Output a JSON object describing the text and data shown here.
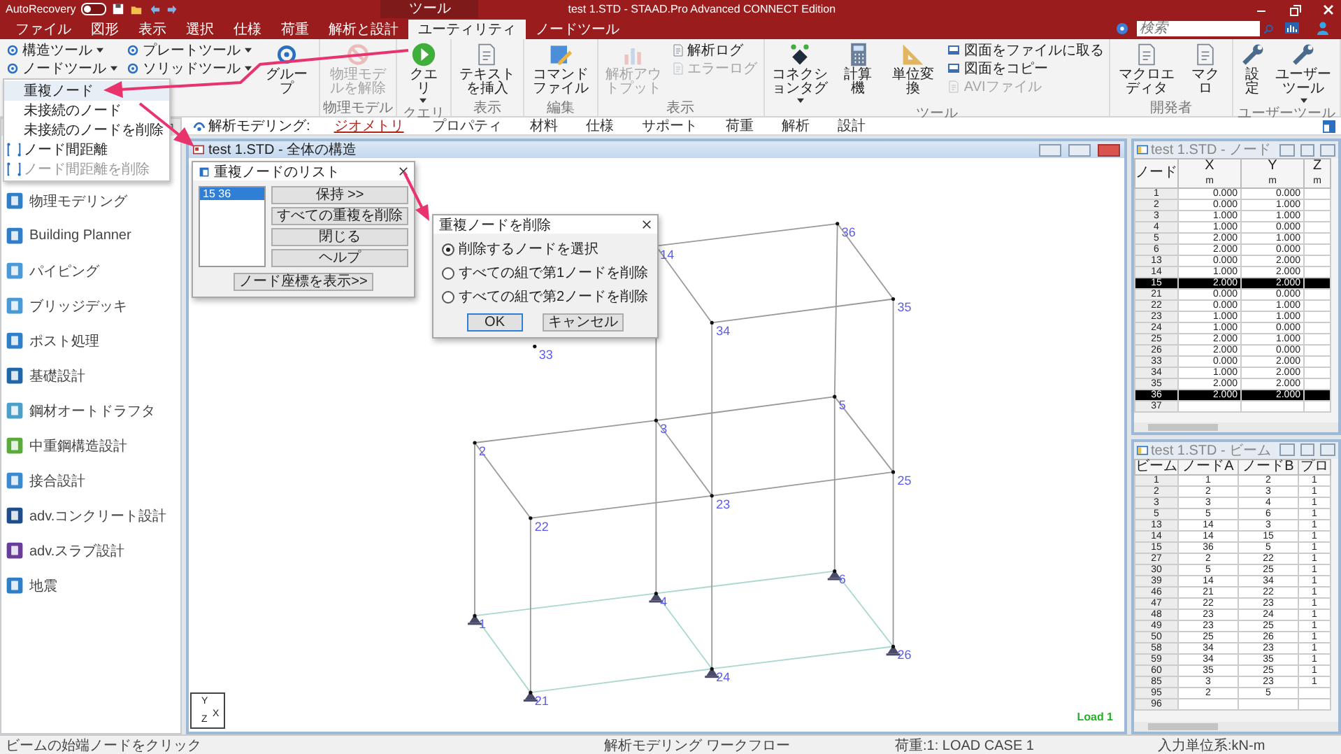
{
  "title_bar": {
    "autorecovery": "AutoRecovery",
    "autorecovery_on": false,
    "context_label": "ツール",
    "title": "test 1.STD - STAAD.Pro Advanced CONNECT Edition"
  },
  "tabs": [
    {
      "label": "ファイル",
      "selected": false
    },
    {
      "label": "図形",
      "selected": false
    },
    {
      "label": "表示",
      "selected": false
    },
    {
      "label": "選択",
      "selected": false
    },
    {
      "label": "仕様",
      "selected": false
    },
    {
      "label": "荷重",
      "selected": false
    },
    {
      "label": "解析と設計",
      "selected": false
    },
    {
      "label": "ユーティリティ",
      "selected": true
    },
    {
      "label": "ノードツール",
      "selected": false
    }
  ],
  "search": {
    "placeholder": "検索"
  },
  "ribbon": {
    "groups": [
      {
        "columns": [
          [
            {
              "kind": "small",
              "label": "構造ツール",
              "dropdown": true,
              "disabled": false
            },
            {
              "kind": "small",
              "label": "ノードツール",
              "dropdown": true,
              "disabled": false
            }
          ],
          [
            {
              "kind": "small",
              "label": "プレートツール",
              "dropdown": true,
              "disabled": false
            },
            {
              "kind": "small",
              "label": "ソリッドツール",
              "dropdown": true,
              "disabled": false
            }
          ],
          [
            {
              "kind": "large",
              "label": "グループ",
              "dropdown": false,
              "disabled": false
            }
          ]
        ]
      },
      {
        "label": "物理モデル",
        "columns": [
          [
            {
              "kind": "large",
              "label": "物理モデルを解除",
              "dropdown": false,
              "disabled": true
            }
          ]
        ]
      },
      {
        "label": "クエリ",
        "columns": [
          [
            {
              "kind": "large",
              "label": "クエリ",
              "dropdown": true,
              "disabled": false
            }
          ]
        ]
      },
      {
        "label": "表示",
        "columns": [
          [
            {
              "kind": "large",
              "label": "テキストを挿入",
              "dropdown": false,
              "disabled": false
            }
          ]
        ]
      },
      {
        "label": "編集",
        "columns": [
          [
            {
              "kind": "large",
              "label": "コマンドファイル",
              "dropdown": false,
              "disabled": false
            }
          ]
        ]
      },
      {
        "label": "表示",
        "columns": [
          [
            {
              "kind": "large",
              "label": "解析アウトプット",
              "dropdown": false,
              "disabled": true
            }
          ],
          [
            {
              "kind": "small",
              "label": "解析ログ",
              "dropdown": false,
              "disabled": false
            },
            {
              "kind": "small",
              "label": "エラーログ",
              "dropdown": false,
              "disabled": true
            }
          ]
        ]
      },
      {
        "label": "ツール",
        "columns": [
          [
            {
              "kind": "large",
              "label": "コネクションタグ",
              "dropdown": true,
              "disabled": false
            }
          ],
          [
            {
              "kind": "large",
              "label": "計算機",
              "dropdown": false,
              "disabled": false
            }
          ],
          [
            {
              "kind": "large",
              "label": "単位変換",
              "dropdown": false,
              "disabled": false
            }
          ],
          [
            {
              "kind": "small",
              "label": "図面をファイルに取る",
              "dropdown": false,
              "disabled": false
            },
            {
              "kind": "small",
              "label": "図面をコピー",
              "dropdown": false,
              "disabled": false
            },
            {
              "kind": "small",
              "label": "AVIファイル",
              "dropdown": false,
              "disabled": true
            }
          ]
        ]
      },
      {
        "label": "開発者",
        "columns": [
          [
            {
              "kind": "large",
              "label": "マクロエディタ",
              "dropdown": false,
              "disabled": false
            }
          ],
          [
            {
              "kind": "large",
              "label": "マクロ",
              "dropdown": false,
              "disabled": false
            }
          ]
        ]
      },
      {
        "label": "ユーザーツール",
        "columns": [
          [
            {
              "kind": "large",
              "label": "設定",
              "dropdown": false,
              "disabled": false
            }
          ],
          [
            {
              "kind": "large",
              "label": "ユーザーツール",
              "dropdown": true,
              "disabled": false
            }
          ]
        ]
      }
    ]
  },
  "node_menu": {
    "items": [
      {
        "label": "重複ノード",
        "kind": "text",
        "disabled": false
      },
      {
        "label": "未接続のノード",
        "kind": "text",
        "disabled": false
      },
      {
        "label": "未接続のノードを削除",
        "kind": "text",
        "disabled": false
      },
      {
        "label": "ノード間距離",
        "kind": "icon",
        "disabled": false
      },
      {
        "label": "ノード間距離を削除",
        "kind": "icon",
        "disabled": true
      }
    ]
  },
  "workflow": {
    "label": "解析モデリング:",
    "steps": [
      {
        "label": "ジオメトリ",
        "selected": true
      },
      {
        "label": "プロパティ",
        "selected": false
      },
      {
        "label": "材料",
        "selected": false
      },
      {
        "label": "仕様",
        "selected": false
      },
      {
        "label": "サポート",
        "selected": false
      },
      {
        "label": "荷重",
        "selected": false
      },
      {
        "label": "解析",
        "selected": false
      },
      {
        "label": "設計",
        "selected": false
      }
    ]
  },
  "sidebar": {
    "items": [
      {
        "label": "物理モデリング"
      },
      {
        "label": "Building Planner"
      },
      {
        "label": "パイピング"
      },
      {
        "label": "ブリッジデッキ"
      },
      {
        "label": "ポスト処理"
      },
      {
        "label": "基礎設計"
      },
      {
        "label": "鋼材オートドラフタ"
      },
      {
        "label": "中重鋼構造設計"
      },
      {
        "label": "接合設計"
      },
      {
        "label": "adv.コンクリート設計"
      },
      {
        "label": "adv.スラブ設計"
      },
      {
        "label": "地震"
      }
    ]
  },
  "viewport": {
    "title": "test 1.STD - 全体の構造",
    "node_labels": [
      "14",
      "36",
      "34",
      "35",
      "33",
      "3",
      "5",
      "2",
      "25",
      "23",
      "22",
      "4",
      "6",
      "1",
      "26",
      "24",
      "21"
    ],
    "axis": [
      "Y",
      "X",
      "Z"
    ],
    "load_label": "Load 1"
  },
  "duplicate_list_dialog": {
    "title": "重複ノードのリスト",
    "list": [
      {
        "label": "15 36",
        "selected": true
      }
    ],
    "buttons": [
      "保持 >>",
      "すべての重複を削除",
      "閉じる",
      "ヘルプ"
    ],
    "footer_button": "ノード座標を表示>>"
  },
  "delete_dialog": {
    "title": "重複ノードを削除",
    "options": [
      {
        "label": "削除するノードを選択",
        "selected": true
      },
      {
        "label": "すべての組で第1ノードを削除",
        "selected": false
      },
      {
        "label": "すべての組で第2ノードを削除",
        "selected": false
      }
    ],
    "buttons": [
      "OK",
      "キャンセル"
    ]
  },
  "node_table": {
    "title": "test 1.STD - ノード",
    "columns": [
      {
        "label": "ノード"
      },
      {
        "label": "X",
        "unit": "m"
      },
      {
        "label": "Y",
        "unit": "m"
      },
      {
        "label": "Z",
        "unit": "m"
      }
    ],
    "rows": [
      {
        "cells": [
          "1",
          "0.000",
          "0.000"
        ],
        "selected": false
      },
      {
        "cells": [
          "2",
          "0.000",
          "1.000"
        ],
        "selected": false
      },
      {
        "cells": [
          "3",
          "1.000",
          "1.000"
        ],
        "selected": false
      },
      {
        "cells": [
          "4",
          "1.000",
          "0.000"
        ],
        "selected": false
      },
      {
        "cells": [
          "5",
          "2.000",
          "1.000"
        ],
        "selected": false
      },
      {
        "cells": [
          "6",
          "2.000",
          "0.000"
        ],
        "selected": false
      },
      {
        "cells": [
          "13",
          "0.000",
          "2.000"
        ],
        "selected": false
      },
      {
        "cells": [
          "14",
          "1.000",
          "2.000"
        ],
        "selected": false
      },
      {
        "cells": [
          "15",
          "2.000",
          "2.000"
        ],
        "selected": true
      },
      {
        "cells": [
          "21",
          "0.000",
          "0.000"
        ],
        "selected": false
      },
      {
        "cells": [
          "22",
          "0.000",
          "1.000"
        ],
        "selected": false
      },
      {
        "cells": [
          "23",
          "1.000",
          "1.000"
        ],
        "selected": false
      },
      {
        "cells": [
          "24",
          "1.000",
          "0.000"
        ],
        "selected": false
      },
      {
        "cells": [
          "25",
          "2.000",
          "1.000"
        ],
        "selected": false
      },
      {
        "cells": [
          "26",
          "2.000",
          "0.000"
        ],
        "selected": false
      },
      {
        "cells": [
          "33",
          "0.000",
          "2.000"
        ],
        "selected": false
      },
      {
        "cells": [
          "34",
          "1.000",
          "2.000"
        ],
        "selected": false
      },
      {
        "cells": [
          "35",
          "2.000",
          "2.000"
        ],
        "selected": false
      },
      {
        "cells": [
          "36",
          "2.000",
          "2.000"
        ],
        "selected": true
      },
      {
        "cells": [
          "37"
        ],
        "selected": false
      }
    ]
  },
  "beam_table": {
    "title": "test 1.STD - ビーム",
    "columns": [
      {
        "label": "ビーム"
      },
      {
        "label": "ノードA"
      },
      {
        "label": "ノードB"
      },
      {
        "label": "プロ"
      }
    ],
    "rows": [
      {
        "cells": [
          "1",
          "1",
          "2",
          "1"
        ]
      },
      {
        "cells": [
          "2",
          "2",
          "3",
          "1"
        ]
      },
      {
        "cells": [
          "3",
          "3",
          "4",
          "1"
        ]
      },
      {
        "cells": [
          "5",
          "5",
          "6",
          "1"
        ]
      },
      {
        "cells": [
          "13",
          "14",
          "3",
          "1"
        ]
      },
      {
        "cells": [
          "14",
          "14",
          "15",
          "1"
        ]
      },
      {
        "cells": [
          "15",
          "36",
          "5",
          "1"
        ]
      },
      {
        "cells": [
          "27",
          "2",
          "22",
          "1"
        ]
      },
      {
        "cells": [
          "30",
          "5",
          "25",
          "1"
        ]
      },
      {
        "cells": [
          "39",
          "14",
          "34",
          "1"
        ]
      },
      {
        "cells": [
          "46",
          "21",
          "22",
          "1"
        ]
      },
      {
        "cells": [
          "47",
          "22",
          "23",
          "1"
        ]
      },
      {
        "cells": [
          "48",
          "23",
          "24",
          "1"
        ]
      },
      {
        "cells": [
          "49",
          "23",
          "25",
          "1"
        ]
      },
      {
        "cells": [
          "50",
          "25",
          "26",
          "1"
        ]
      },
      {
        "cells": [
          "58",
          "34",
          "23",
          "1"
        ]
      },
      {
        "cells": [
          "59",
          "34",
          "35",
          "1"
        ]
      },
      {
        "cells": [
          "60",
          "35",
          "25",
          "1"
        ]
      },
      {
        "cells": [
          "85",
          "3",
          "23",
          "1"
        ]
      },
      {
        "cells": [
          "95",
          "2",
          "5"
        ]
      },
      {
        "cells": [
          "96"
        ]
      }
    ]
  },
  "status_bar": [
    "ビームの始端ノードをクリック",
    "解析モデリング ワークフロー",
    "荷重:1: LOAD CASE 1",
    "入力単位系:kN-m"
  ]
}
